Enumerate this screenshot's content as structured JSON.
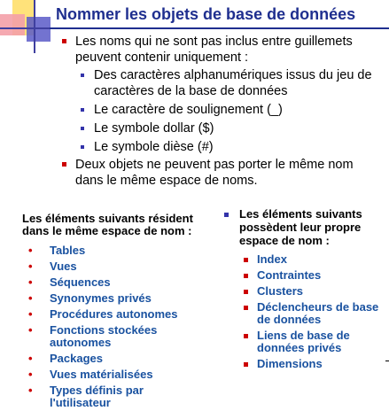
{
  "title": "Nommer les objets de base de données",
  "bullets": [
    {
      "level": 1,
      "text_lines": [
        "Les noms qui ne sont pas inclus entre guillemets",
        "peuvent contenir uniquement :"
      ]
    },
    {
      "level": 2,
      "text_lines": [
        "Des caractères alphanumériques issus du jeu de",
        "caractères de la base de données"
      ]
    },
    {
      "level": 2,
      "text_lines": [
        "Le caractère de soulignement (_)"
      ]
    },
    {
      "level": 2,
      "text_lines": [
        "Le symbole dollar ($)"
      ]
    },
    {
      "level": 2,
      "text_lines": [
        "Le symbole dièse (#)"
      ]
    },
    {
      "level": 1,
      "text_lines": [
        "Deux objets ne peuvent pas porter le même nom",
        "dans le même espace de noms."
      ]
    }
  ],
  "left_section": {
    "heading_lines": [
      "Les éléments suivants résident",
      "dans le même espace de nom :"
    ],
    "items": [
      [
        "Tables"
      ],
      [
        "Vues"
      ],
      [
        "Séquences"
      ],
      [
        "Synonymes privés"
      ],
      [
        "Procédures autonomes"
      ],
      [
        "Fonctions stockées",
        "autonomes"
      ],
      [
        "Packages"
      ],
      [
        "Vues matérialisées"
      ],
      [
        "Types définis par",
        "l'utilisateur"
      ]
    ]
  },
  "right_section": {
    "heading_lines": [
      "Les éléments suivants",
      "possèdent leur propre",
      "espace de nom :"
    ],
    "items": [
      [
        "Index"
      ],
      [
        "Contraintes"
      ],
      [
        "Clusters"
      ],
      [
        "Déclencheurs de base",
        "de données"
      ],
      [
        "Liens de base de",
        "données privés"
      ],
      [
        "Dimensions"
      ]
    ]
  },
  "colors": {
    "title": "#1f2f8f",
    "item_text": "#1a52a0",
    "bullet_red": "#cc0000",
    "bullet_blue": "#3333aa",
    "deco_yellow": "#ffe27a",
    "deco_pink": "#f4a0a8",
    "deco_blue": "#5a5ac8"
  }
}
